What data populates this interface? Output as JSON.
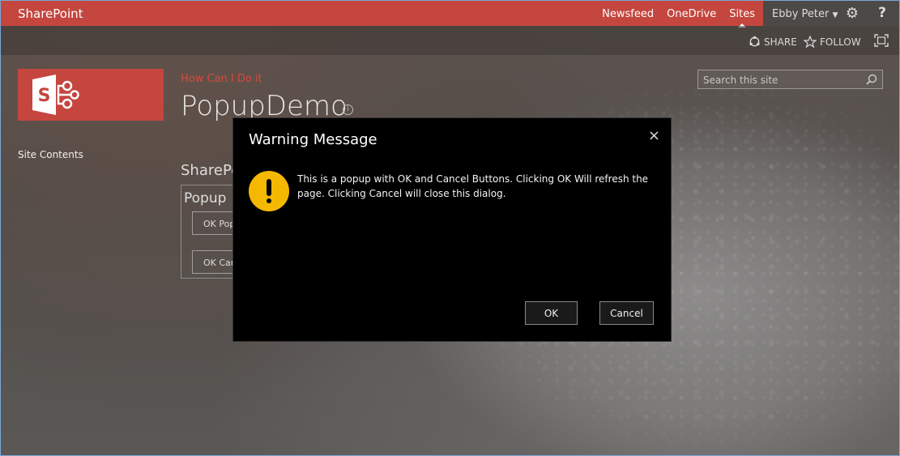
{
  "suitebar": {
    "brand": "SharePoint",
    "links": [
      "Newsfeed",
      "OneDrive",
      "Sites"
    ],
    "user_name": "Ebby Peter",
    "help": "?"
  },
  "actions": {
    "share": "SHARE",
    "follow": "FOLLOW"
  },
  "site": {
    "breadcrumb": "How Can I Do it",
    "title": "PopupDemo",
    "nav_site_contents": "Site Contents",
    "search_placeholder": "Search this site",
    "webpart_title": "SharePo",
    "webpart_subtitle": "Popup",
    "button1_partial": "OK Pop",
    "button2_partial": "OK Car"
  },
  "dialog": {
    "title": "Warning Message",
    "close": "×",
    "message": "This is a popup with OK and Cancel Buttons. Clicking OK Will refresh the page. Clicking Cancel will close this dialog.",
    "ok_label": "OK",
    "cancel_label": "Cancel"
  },
  "colors": {
    "suitebar": "#c4463e",
    "accent_text": "#d74b3e",
    "warning": "#f5b800",
    "dialog_bg": "#000000"
  }
}
